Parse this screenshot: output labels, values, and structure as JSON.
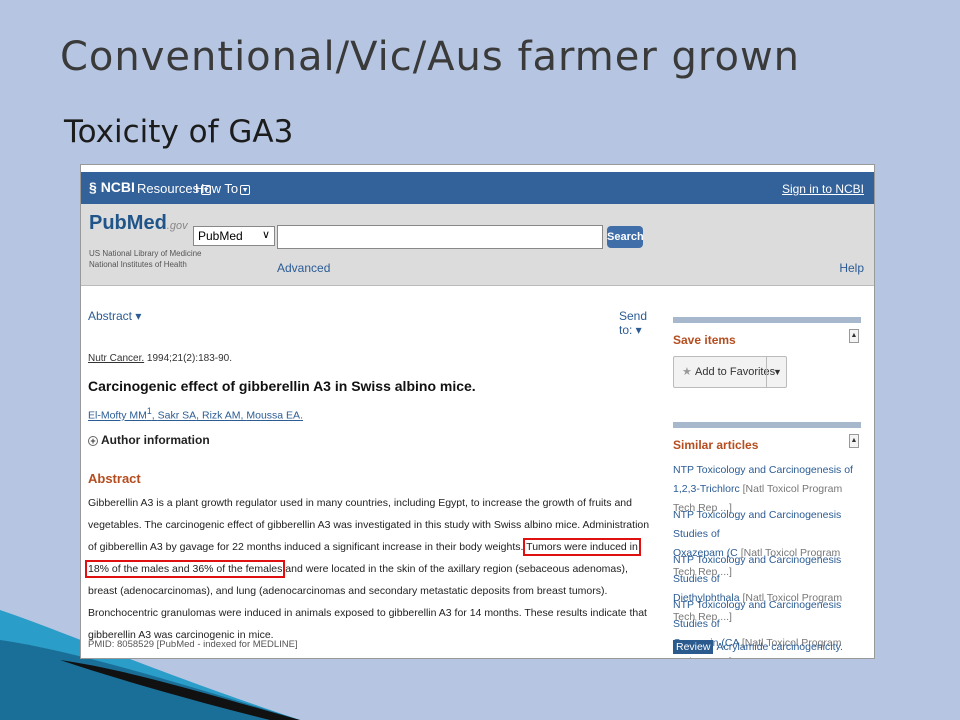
{
  "slide": {
    "title": "Conventional/Vic/Aus farmer grown",
    "subtitle": "Toxicity of GA3"
  },
  "ncbi": {
    "logo": "NCBI",
    "resources": "Resources",
    "howto": "How To",
    "signin": "Sign in to NCBI"
  },
  "search": {
    "logo_pub": "Pub",
    "logo_med": "Med",
    "logo_gov": ".gov",
    "sub1": "US National Library of Medicine",
    "sub2": "National Institutes of Health",
    "db": "PubMed",
    "query": "",
    "button": "Search",
    "advanced": "Advanced",
    "help": "Help"
  },
  "article": {
    "format": "Abstract",
    "send_to": "Send to:",
    "journal": "Nutr Cancer.",
    "cite_rest": "1994;21(2):183-90.",
    "title": "Carcinogenic effect of gibberellin A3 in Swiss albino mice.",
    "authors": [
      "El-Mofty MM",
      "Sakr SA",
      "Rizk AM",
      "Moussa EA"
    ],
    "author_sup": "1",
    "author_info": "Author information",
    "abstract_heading": "Abstract",
    "abstract_pre": "Gibberellin A3 is a plant growth regulator used in many countries, including Egypt, to increase the growth of fruits and vegetables. The carcinogenic effect of gibberellin A3 was investigated in this study with Swiss albino mice. Administration of gibberellin A3 by gavage for 22 months induced a significant increase in their body weights.",
    "abstract_highlight": "Tumors were induced in 18% of the males and 36% of the females",
    "abstract_post": "and were located in the skin of the axillary region (sebaceous adenomas), breast (adenocarcinomas), and lung (adenocarcinomas and secondary metastatic deposits from breast tumors). Bronchocentric granulomas were induced in animals exposed to gibberellin A3 for 14 months. These results indicate that gibberellin A3 was carcinogenic in mice.",
    "pmid": "PMID: 8058529 [PubMed - indexed for MEDLINE]"
  },
  "sidebar": {
    "save_heading": "Save items",
    "favorites": "Add to Favorites",
    "similar_heading": "Similar articles",
    "similar": [
      {
        "line1": "NTP Toxicology and Carcinogenesis of",
        "line2": "1,2,3-Trichlorc",
        "src": "[Natl Toxicol Program Tech Rep ...]"
      },
      {
        "line1": "NTP Toxicology and Carcinogenesis Studies of",
        "line2": "Oxazepam (C",
        "src": "[Natl Toxicol Program Tech Rep ...]"
      },
      {
        "line1": "NTP Toxicology and Carcinogenesis Studies of",
        "line2": "Diethylphthala",
        "src": "[Natl Toxicol Program Tech Rep ...]"
      },
      {
        "line1": "NTP Toxicology and Carcinogenesis Studies of",
        "line2": "Coumarin (CA",
        "src": "[Natl Toxicol Program Tech Rep ...]"
      }
    ],
    "review_tag": "Review",
    "review_title": "Acrylamide carcinogenicity."
  }
}
